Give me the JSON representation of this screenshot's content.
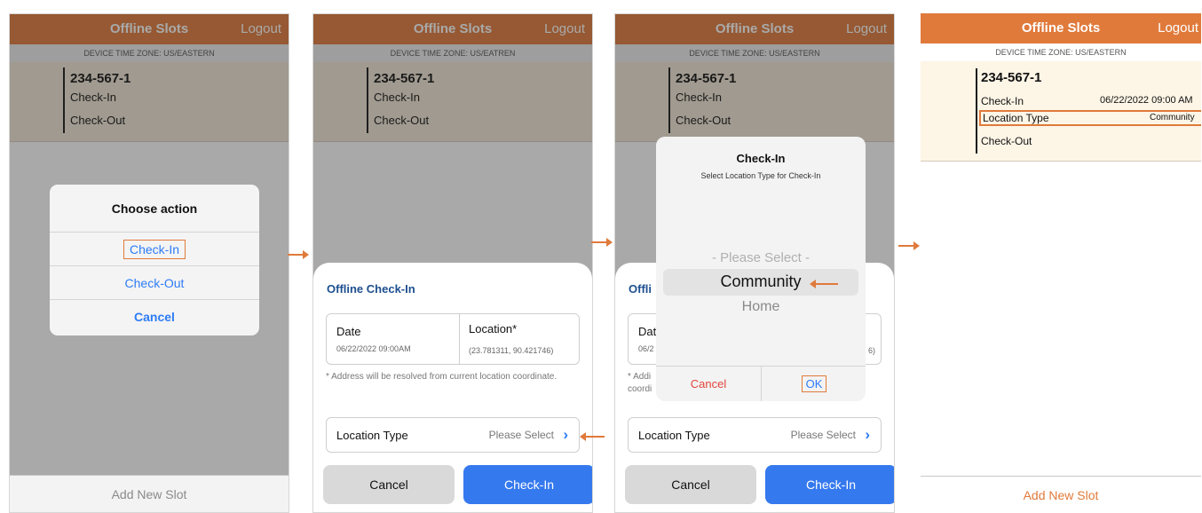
{
  "app": {
    "title": "Offline Slots",
    "logout": "Logout",
    "add_slot": "Add New Slot"
  },
  "timezone": {
    "panel1": "DEVICE TIME ZONE: US/EASTERN",
    "panel2": "DEVICE TIME ZONE: US/EATREN",
    "panel3": "DEVICE TIME ZONE: US/EASTERN",
    "panel4": "DEVICE TIME ZONE: US/EASTERN"
  },
  "slot": {
    "id": "234-567-1",
    "checkin": "Check-In",
    "checkout": "Check-Out",
    "location_type": "Location Type"
  },
  "action_sheet": {
    "title": "Choose action",
    "items": [
      "Check-In",
      "Check-Out",
      "Cancel"
    ]
  },
  "checkin_sheet": {
    "title": "Offline Check-In",
    "date_label": "Date",
    "date_value": "06/22/2022 09:00AM",
    "location_label": "Location*",
    "location_value": "(23.781311, 90.421746)",
    "note": "* Address will be resolved from current location coordinate.",
    "location_type_label": "Location Type",
    "location_type_value": "Please Select",
    "cancel": "Cancel",
    "submit": "Check-In"
  },
  "picker": {
    "title": "Check-In",
    "subtitle": "Select Location Type for Check-In",
    "options": [
      "- Please Select -",
      "Community",
      "Home"
    ],
    "selected": "Community",
    "cancel": "Cancel",
    "ok": "OK"
  },
  "panel3_partial": {
    "sheet_title": "Offli",
    "date_label": "Dat",
    "date_value": "06/2",
    "location_tail": "6)",
    "note_line1": "* Addi",
    "note_line2": "coordi"
  },
  "result": {
    "checkin_time": "06/22/2022 09:00 AM",
    "location_type_value": "Community"
  },
  "colors": {
    "accent": "#e07a3b",
    "blue": "#2d7cf6",
    "header_text": "#ffffff"
  }
}
